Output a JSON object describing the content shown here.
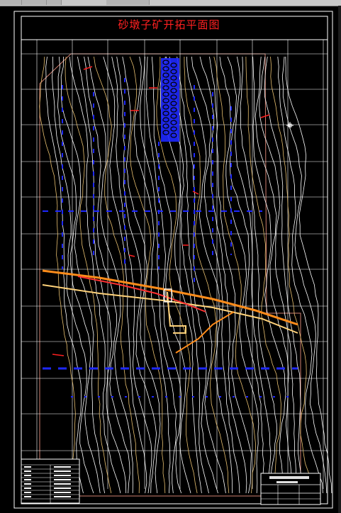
{
  "app": {
    "chrome_tabs": 4
  },
  "drawing": {
    "title": "砂墩子矿开拓平面图",
    "title_color": "#ff2020"
  },
  "colors": {
    "background": "#000000",
    "frame": "#ffffff",
    "grid": "#ffffff",
    "contour": "#ffffff",
    "contour_alt": "#e8c070",
    "boundary": "#d08070",
    "ore_body": "#1e28ff",
    "tunnel": "#ff8c1a",
    "tunnel_alt": "#ffd27a",
    "annotation": "#ff2020"
  },
  "icons": {
    "cursor": "crosshair-cursor-icon"
  }
}
